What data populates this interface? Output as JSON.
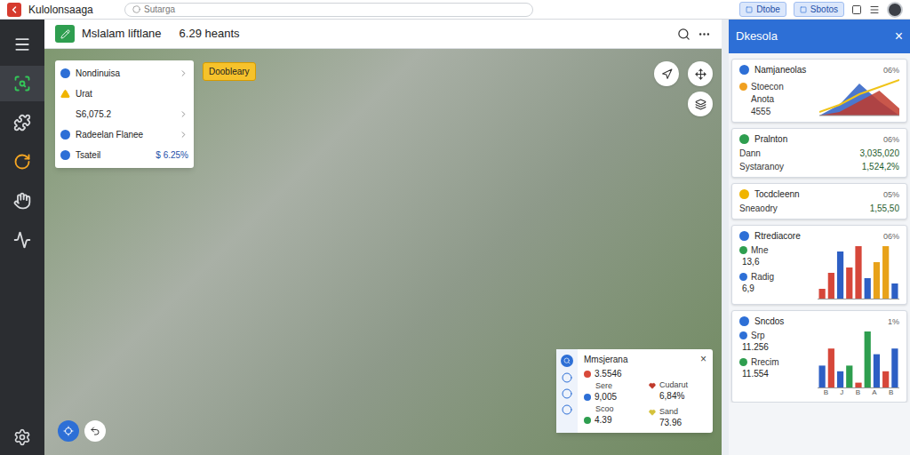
{
  "app": {
    "name": "Kulolonsaaga",
    "search_placeholder": "Sutarga",
    "buttons": [
      "Dtobe",
      "Sbotos"
    ]
  },
  "sidebar": {
    "items": [
      {
        "selected": false
      },
      {
        "selected": true
      },
      {
        "selected": false
      },
      {
        "selected": false
      },
      {
        "selected": false
      },
      {
        "selected": false
      }
    ]
  },
  "header": {
    "title": "Mslalam liftlane",
    "reading": "6.29 heants"
  },
  "info_card": {
    "rows": [
      {
        "label": "Nondinuisa",
        "color": "#2d6fd6",
        "chevron": true
      },
      {
        "label": "Urat",
        "color": "#f0b400",
        "chevron": false
      },
      {
        "label": "S6,075.2",
        "chevron": true
      },
      {
        "label": "Radeelan Flanee",
        "color": "#2d6fd6",
        "chevron": true
      },
      {
        "label": "Tsateil",
        "value": "$ 6.25%",
        "color": "#2d6fd6",
        "chevron": false
      }
    ]
  },
  "badge": "Doobleary",
  "legend_card": {
    "title": "Mmsjerana",
    "close": "×",
    "left": [
      {
        "value": "3.5546",
        "color": "#d84a3a"
      },
      {
        "label": "Sere",
        "value": "9,005",
        "color": "#2d6fd6"
      },
      {
        "label": "Scoo",
        "value": "4.39",
        "color": "#2e9e4f"
      }
    ],
    "right": [
      {
        "label": "Cudarut",
        "value": "6,84%",
        "color": "#c0392b"
      },
      {
        "label": "Sand",
        "value": "73.96",
        "color": "#d4c13a"
      }
    ]
  },
  "panel": {
    "title": "Dkesola",
    "close": "×",
    "cards": [
      {
        "title": "Namjaneolas",
        "pct": "06%",
        "color": "#2d6fd6",
        "kind": "area",
        "rows": [
          {
            "label": "Stoecon",
            "color": "#f0a020"
          },
          {
            "label": "Anota"
          },
          {
            "label": "4555"
          }
        ],
        "max": 10,
        "series": [
          {
            "kind": "area",
            "color": "#2d5fc4",
            "values": [
              0,
              3,
              9,
              4,
              0
            ]
          },
          {
            "kind": "area",
            "color": "#c0392b",
            "values": [
              0,
              1,
              4,
              7,
              2
            ]
          },
          {
            "kind": "line",
            "color": "#f0c419",
            "values": [
              1,
              3,
              6,
              8,
              10
            ]
          }
        ]
      },
      {
        "title": "Pralnton",
        "pct": "06%",
        "color": "#2e9e4f",
        "kind": "table",
        "rows": [
          {
            "label": "Dann",
            "value": "3,035,020"
          },
          {
            "label": "Systaranoy",
            "value": "1,524,2%"
          }
        ]
      },
      {
        "title": "Tocdcleenn",
        "pct": "05%",
        "color": "#f0b400",
        "kind": "table",
        "rows": [
          {
            "label": "Sneaodry",
            "value": "1,55,50"
          }
        ]
      },
      {
        "title": "Rtrediacore",
        "pct": "06%",
        "color": "#2d6fd6",
        "kind": "bars",
        "rows": [
          {
            "label": "Mne",
            "value": "13,6",
            "color": "#2e9e4f"
          },
          {
            "label": "Radig",
            "value": "6,9",
            "color": "#2d6fd6"
          }
        ],
        "max": 10,
        "ticks": [],
        "bars": [
          {
            "value": 2,
            "color": "#d6473a"
          },
          {
            "value": 5,
            "color": "#d6473a"
          },
          {
            "value": 9,
            "color": "#2d5fc4"
          },
          {
            "value": 6,
            "color": "#d6473a"
          },
          {
            "value": 10,
            "color": "#d6473a"
          },
          {
            "value": 4,
            "color": "#2d5fc4"
          },
          {
            "value": 7,
            "color": "#e8a21a"
          },
          {
            "value": 10,
            "color": "#e8a21a"
          },
          {
            "value": 3,
            "color": "#2d5fc4"
          }
        ]
      },
      {
        "title": "Sncdos",
        "pct": "1%",
        "color": "#2d6fd6",
        "kind": "bars",
        "rows": [
          {
            "label": "Srp",
            "value": "11.256",
            "color": "#2d6fd6"
          },
          {
            "label": "Rrecim",
            "value": "11.554",
            "color": "#2e9e4f"
          }
        ],
        "max": 10,
        "ticks": [
          "B",
          "J",
          "B",
          "A",
          "B"
        ],
        "bars": [
          {
            "value": 4,
            "color": "#2d5fc4"
          },
          {
            "value": 7,
            "color": "#d6473a"
          },
          {
            "value": 3,
            "color": "#2d5fc4"
          },
          {
            "value": 4,
            "color": "#2e9e4f"
          },
          {
            "value": 1,
            "color": "#d6473a"
          },
          {
            "value": 10,
            "color": "#2e9e4f"
          },
          {
            "value": 6,
            "color": "#2d5fc4"
          },
          {
            "value": 3,
            "color": "#d6473a"
          },
          {
            "value": 7,
            "color": "#2d5fc4"
          }
        ]
      }
    ]
  }
}
